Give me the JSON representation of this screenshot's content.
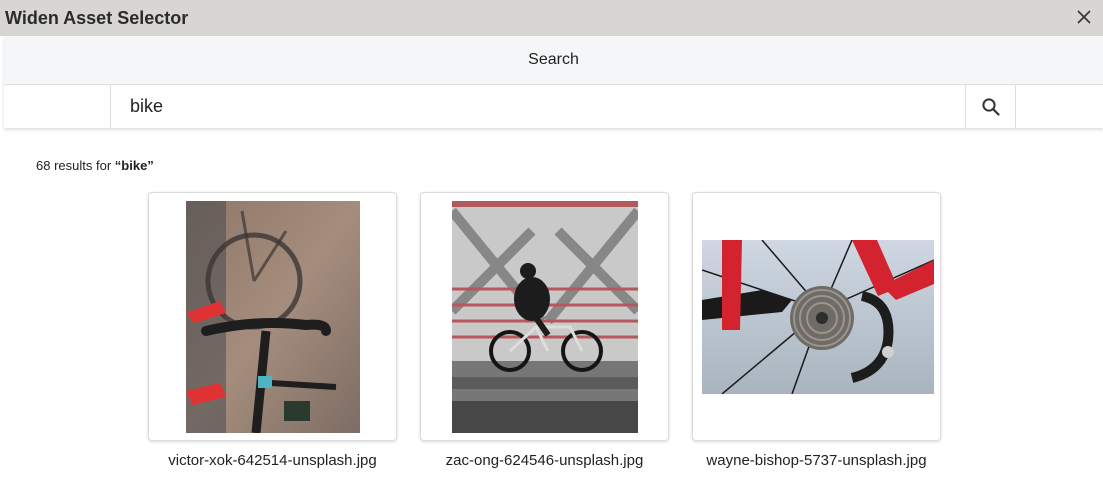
{
  "window": {
    "title": "Widen Asset Selector",
    "close_icon": "close-icon"
  },
  "search": {
    "header_label": "Search",
    "query": "bike",
    "button_icon": "search-icon"
  },
  "results": {
    "count_prefix": "68 results for",
    "count_query": "“bike”",
    "assets": [
      {
        "filename": "victor-xok-642514-unsplash.jpg",
        "thumbnail": "road bike handlebars from above with red shoes"
      },
      {
        "filename": "zac-ong-624546-unsplash.jpg",
        "thumbnail": "cyclist riding across a red bridge"
      },
      {
        "filename": "wayne-bishop-5737-unsplash.jpg",
        "thumbnail": "close-up of rear bike cassette and red frame"
      }
    ]
  },
  "colors": {
    "titlebar": "#d7d6d2",
    "search_header_bg": "#f5f6f7",
    "border": "#dddddd"
  }
}
